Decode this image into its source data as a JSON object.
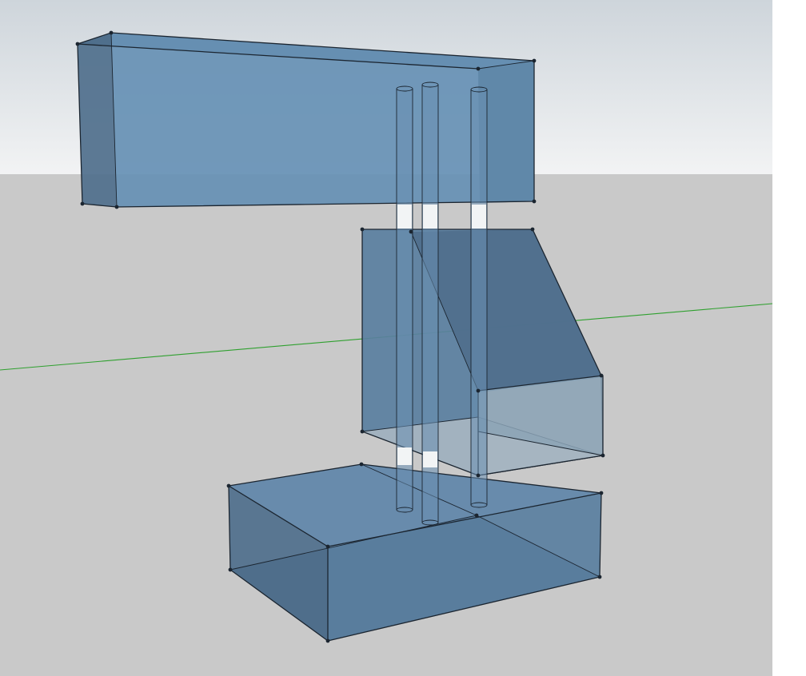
{
  "scene": {
    "sky_color": "#e2e6e9",
    "ground_color": "#c9c9c9",
    "outside_color": "#ffffff",
    "axis_color": "#2fa02f",
    "model_color": "#5b82a6",
    "edge_color": "#1b2530"
  },
  "objects": {
    "top_beam": "box",
    "middle_block": "box",
    "front_step": "box",
    "bottom_base": "box",
    "rods": [
      "cylinder",
      "cylinder",
      "cylinder"
    ]
  },
  "axes": {
    "green_axis": "visible"
  }
}
